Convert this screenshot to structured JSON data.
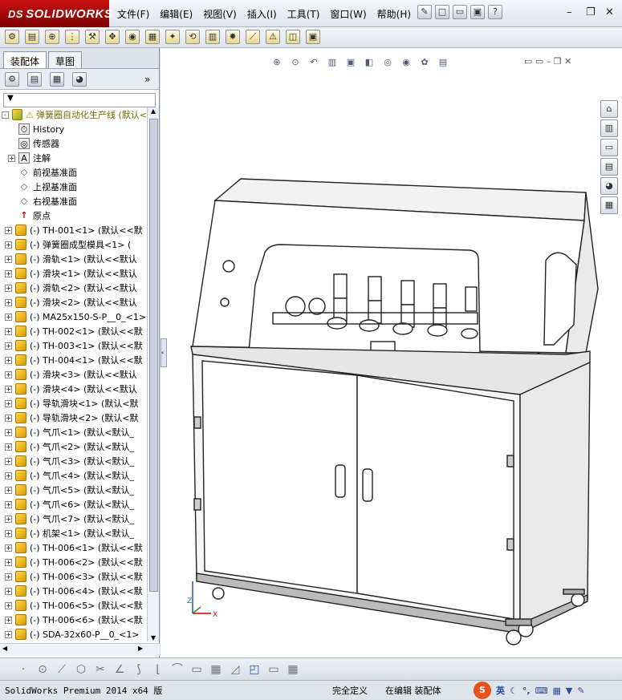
{
  "app": {
    "logo_prefix": "DS",
    "logo_text": "SOLIDWORKS"
  },
  "menu": [
    "文件(F)",
    "编辑(E)",
    "视图(V)",
    "插入(I)",
    "工具(T)",
    "窗口(W)",
    "帮助(H)"
  ],
  "panel": {
    "tabs": [
      "装配体",
      "草图"
    ],
    "tree": [
      {
        "label": "弹簧圈自动化生产线 (默认<",
        "icon": "assembly",
        "expand": "-"
      },
      {
        "label": "History",
        "icon": "history",
        "expand": ""
      },
      {
        "label": "传感器",
        "icon": "sensor",
        "expand": ""
      },
      {
        "label": "注解",
        "icon": "annotation",
        "expand": "+"
      },
      {
        "label": "前视基准面",
        "icon": "plane",
        "expand": ""
      },
      {
        "label": "上视基准面",
        "icon": "plane",
        "expand": ""
      },
      {
        "label": "右视基准面",
        "icon": "plane",
        "expand": ""
      },
      {
        "label": "原点",
        "icon": "origin",
        "expand": ""
      },
      {
        "label": "(-) TH-001<1> (默认<<默",
        "icon": "part",
        "expand": "+"
      },
      {
        "label": "(-) 弹簧圈成型模具<1> (",
        "icon": "part",
        "expand": "+"
      },
      {
        "label": "(-) 滑轨<1> (默认<<默认",
        "icon": "part",
        "expand": "+"
      },
      {
        "label": "(-) 滑块<1> (默认<<默认",
        "icon": "part",
        "expand": "+"
      },
      {
        "label": "(-) 滑轨<2> (默认<<默认",
        "icon": "part",
        "expand": "+"
      },
      {
        "label": "(-) 滑块<2> (默认<<默认",
        "icon": "part",
        "expand": "+"
      },
      {
        "label": "(-) MA25x150-S-P__0_<1>",
        "icon": "part",
        "expand": "+"
      },
      {
        "label": "(-) TH-002<1> (默认<<默",
        "icon": "part",
        "expand": "+"
      },
      {
        "label": "(-) TH-003<1> (默认<<默",
        "icon": "part",
        "expand": "+"
      },
      {
        "label": "(-) TH-004<1> (默认<<默",
        "icon": "part",
        "expand": "+"
      },
      {
        "label": "(-) 滑块<3> (默认<<默认",
        "icon": "part",
        "expand": "+"
      },
      {
        "label": "(-) 滑块<4> (默认<<默认",
        "icon": "part",
        "expand": "+"
      },
      {
        "label": "(-) 导轨滑块<1> (默认<默",
        "icon": "part",
        "expand": "+"
      },
      {
        "label": "(-) 导轨滑块<2> (默认<默",
        "icon": "part",
        "expand": "+"
      },
      {
        "label": "(-) 气爪<1> (默认<默认_",
        "icon": "part",
        "expand": "+"
      },
      {
        "label": "(-) 气爪<2> (默认<默认_",
        "icon": "part",
        "expand": "+"
      },
      {
        "label": "(-) 气爪<3> (默认<默认_",
        "icon": "part",
        "expand": "+"
      },
      {
        "label": "(-) 气爪<4> (默认<默认_",
        "icon": "part",
        "expand": "+"
      },
      {
        "label": "(-) 气爪<5> (默认<默认_",
        "icon": "part",
        "expand": "+"
      },
      {
        "label": "(-) 气爪<6> (默认<默认_",
        "icon": "part",
        "expand": "+"
      },
      {
        "label": "(-) 气爪<7> (默认<默认_",
        "icon": "part",
        "expand": "+"
      },
      {
        "label": "(-) 机架<1> (默认<默认_",
        "icon": "part",
        "expand": "+"
      },
      {
        "label": "(-) TH-006<1> (默认<<默",
        "icon": "part",
        "expand": "+"
      },
      {
        "label": "(-) TH-006<2> (默认<<默",
        "icon": "part",
        "expand": "+"
      },
      {
        "label": "(-) TH-006<3> (默认<<默",
        "icon": "part",
        "expand": "+"
      },
      {
        "label": "(-) TH-006<4> (默认<<默",
        "icon": "part",
        "expand": "+"
      },
      {
        "label": "(-) TH-006<5> (默认<<默",
        "icon": "part",
        "expand": "+"
      },
      {
        "label": "(-) TH-006<6> (默认<<默",
        "icon": "part",
        "expand": "+"
      },
      {
        "label": "(-) SDA-32x60-P__0_<1>",
        "icon": "part",
        "expand": "+"
      }
    ]
  },
  "triad": {
    "x": "X",
    "z": "Z"
  },
  "status": {
    "product": "SolidWorks Premium 2014 x64 版",
    "definition": "完全定义",
    "mode": "在编辑 装配体",
    "ime_lang": "英"
  },
  "colors": {
    "brand": "#a80d0d",
    "accent": "#1f5fb8"
  }
}
